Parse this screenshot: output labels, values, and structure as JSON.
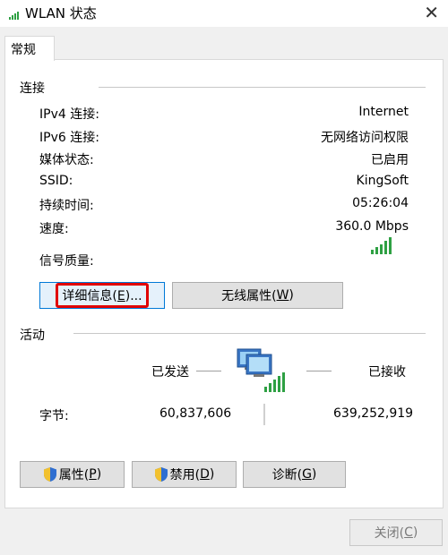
{
  "window": {
    "title": "WLAN 状态"
  },
  "tabs": [
    {
      "label": "常规"
    }
  ],
  "connection": {
    "title": "连接",
    "rows": [
      {
        "label": "IPv4 连接:",
        "value": "Internet"
      },
      {
        "label": "IPv6 连接:",
        "value": "无网络访问权限"
      },
      {
        "label": "媒体状态:",
        "value": "已启用"
      },
      {
        "label": "SSID:",
        "value": "KingSoft"
      },
      {
        "label": "持续时间:",
        "value": "05:26:04"
      },
      {
        "label": "速度:",
        "value": "360.0 Mbps"
      }
    ],
    "signal_label": "信号质量:",
    "signal_bars": 5
  },
  "buttons": {
    "details": {
      "text": "详细信息(",
      "key": "E",
      "suffix": ")..."
    },
    "wireless": {
      "text": "无线属性(",
      "key": "W",
      "suffix": ")"
    }
  },
  "activity": {
    "title": "活动",
    "sent_label": "已发送",
    "received_label": "已接收",
    "bytes_label": "字节:",
    "bytes_sent": "60,837,606",
    "bytes_received": "639,252,919"
  },
  "action_buttons": {
    "properties": {
      "text": "属性(",
      "key": "P",
      "suffix": ")"
    },
    "disable": {
      "text": "禁用(",
      "key": "D",
      "suffix": ")"
    },
    "diagnose": {
      "text": "诊断(",
      "key": "G",
      "suffix": ")"
    }
  },
  "footer": {
    "close": {
      "text": "关闭(",
      "key": "C",
      "suffix": ")"
    }
  },
  "colors": {
    "signal_green": "#2ea043",
    "highlight_red": "#e00000",
    "accent_blue": "#0078d7"
  },
  "icons": [
    "wifi-signal-icon",
    "close-icon",
    "network-computers-icon",
    "shield-icon"
  ]
}
